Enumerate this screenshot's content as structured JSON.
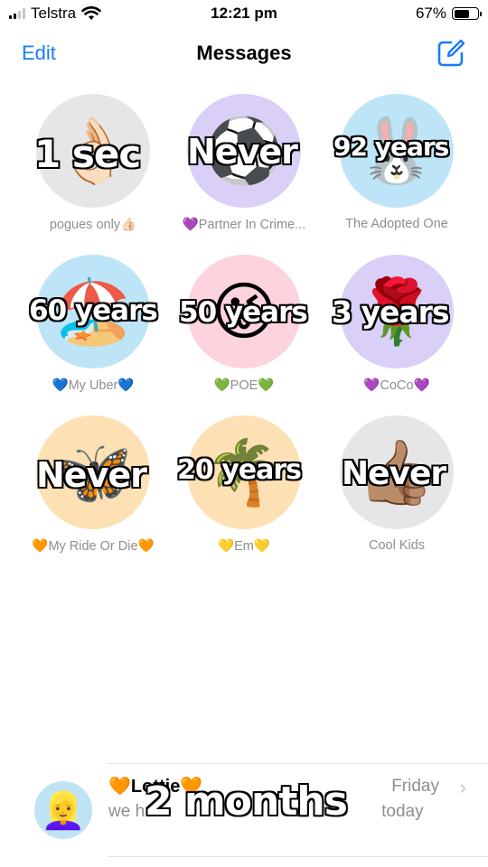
{
  "status_bar": {
    "carrier": "Telstra",
    "time": "12:21 pm",
    "battery": "67%",
    "battery_level": 0.67
  },
  "nav": {
    "edit": "Edit",
    "title": "Messages",
    "compose_icon": "compose-icon"
  },
  "pins": [
    {
      "label": "pogues only👍🏻",
      "emoji": "👌🏻",
      "bg": "#e6e6e8",
      "overlay": "1 sec"
    },
    {
      "label": "💜Partner In Crime...",
      "emoji": "⚽",
      "bg": "#d9cff7",
      "overlay": "Never"
    },
    {
      "label": "The Adopted One",
      "emoji": "🐰",
      "bg": "#bde5f7",
      "overlay": "92 years"
    },
    {
      "label": "💙My Uber💙",
      "emoji": "🏖️",
      "bg": "#bde5f7",
      "overlay": "60 years"
    },
    {
      "label": "💚POE💚",
      "emoji": "😜",
      "bg": "#fdd3dd",
      "overlay": "50 years"
    },
    {
      "label": "💜CoCo💜",
      "emoji": "🌹",
      "bg": "#d9cff7",
      "overlay": "3 years"
    },
    {
      "label": "🧡My Ride Or Die🧡",
      "emoji": "🦋",
      "bg": "#fde0b4",
      "overlay": "Never"
    },
    {
      "label": "💛Em💛",
      "emoji": "🌴",
      "bg": "#fde0b4",
      "overlay": "20 years"
    },
    {
      "label": "Cool Kids",
      "emoji": "👍🏽",
      "bg": "#e6e6e8",
      "overlay": "Never"
    }
  ],
  "conversation": {
    "name": "🧡Lottie🧡",
    "preview_start": "we h",
    "preview_end": "today",
    "time": "Friday",
    "avatar_emoji": "👱‍♀️",
    "overlay": "2 months"
  }
}
